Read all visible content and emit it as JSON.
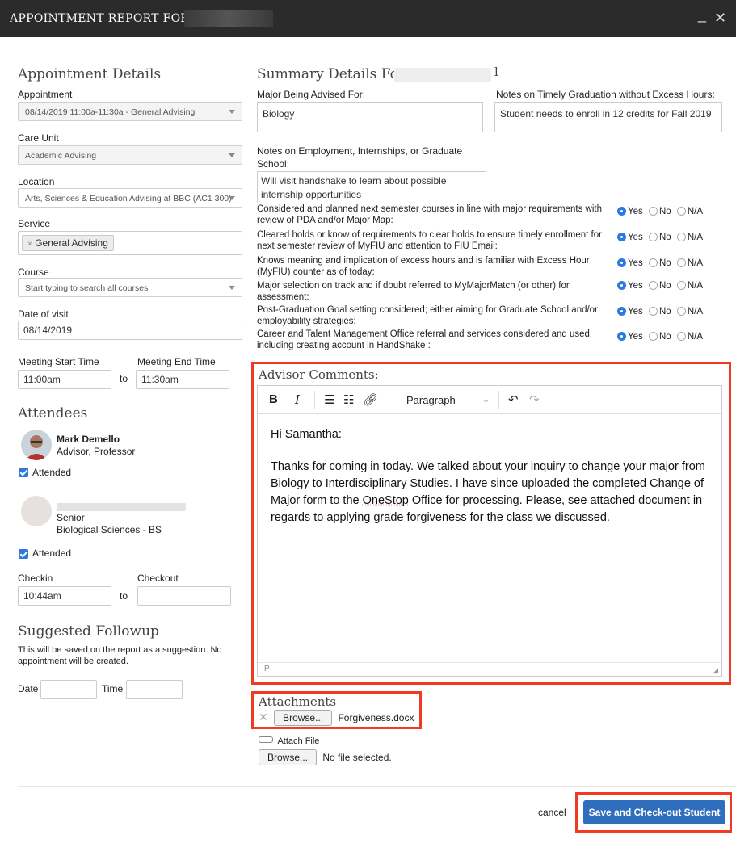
{
  "window": {
    "title": "APPOINTMENT REPORT FOR S",
    "minimize": "_",
    "close": "✕"
  },
  "left": {
    "section_title": "Appointment Details",
    "appointment": {
      "label": "Appointment",
      "value": "08/14/2019 11:00a-11:30a - General Advising"
    },
    "care_unit": {
      "label": "Care Unit",
      "value": "Academic Advising"
    },
    "location": {
      "label": "Location",
      "value": "Arts, Sciences & Education Advising at BBC (AC1 300)"
    },
    "service": {
      "label": "Service",
      "tag": "General Advising",
      "tag_x": "×"
    },
    "course": {
      "label": "Course",
      "placeholder": "Start typing to search all courses"
    },
    "date_of_visit": {
      "label": "Date of visit",
      "value": "08/14/2019"
    },
    "meeting": {
      "start_label": "Meeting Start Time",
      "end_label": "Meeting End Time",
      "start": "11:00am",
      "end": "11:30am",
      "to": "to"
    },
    "attendees": {
      "title": "Attendees",
      "advisor_name": "Mark Demello",
      "advisor_role": "Advisor, Professor",
      "attended1": "Attended",
      "student_level": "Senior",
      "student_program": "Biological Sciences - BS",
      "attended2": "Attended"
    },
    "checkin": {
      "label": "Checkin",
      "value": "10:44am",
      "checkout_label": "Checkout",
      "to": "to"
    },
    "followup": {
      "title": "Suggested Followup",
      "note": "This will be saved on the report as a suggestion. No appointment will be created.",
      "date_label": "Date",
      "time_label": "Time"
    }
  },
  "right": {
    "summary_title": "Summary Details For",
    "summary_suffix": "l",
    "major_label": "Major Being Advised For:",
    "major_value": "Biology",
    "timely_label": "Notes on Timely Graduation without Excess Hours:",
    "timely_value": "Student needs to enroll in 12 credits for Fall 2019",
    "employment_label": "Notes on Employment, Internships, or Graduate School:",
    "employment_value": "Will visit handshake to learn about possible internship opportunities",
    "radio_labels": {
      "yes": "Yes",
      "no": "No",
      "na": "N/A"
    },
    "questions": [
      {
        "text": "Considered and planned next semester courses in line with major requirements with review of PDA and/or Major Map:"
      },
      {
        "text": "Cleared holds or know of requirements to clear holds to ensure timely enrollment for next semester review of MyFIU and attention to FIU Email:"
      },
      {
        "text": "Knows meaning and implication of excess hours and is familiar with Excess Hour (MyFIU) counter as of today:"
      },
      {
        "text": "Major selection on track and if doubt referred to MyMajorMatch (or other) for assessment:"
      },
      {
        "text": "Post-Graduation Goal setting considered; either aiming for Graduate School and/or employability strategies:"
      },
      {
        "text": "Career and Talent Management Office referral and services considered and used, including creating account in HandShake :"
      }
    ],
    "comments": {
      "title": "Advisor Comments:",
      "format": "Paragraph",
      "greeting": "Hi Samantha:",
      "body_1": "Thanks for coming in today. We talked about your inquiry to change your major from Biology to Interdisciplinary Studies. I have since uploaded the completed Change of Major form to the ",
      "body_link": "OneStop",
      "body_2": " Office for processing. Please, see attached document in regards to applying grade forgiveness for the class we discussed.",
      "status": "P"
    },
    "attachments": {
      "title": "Attachments",
      "browse": "Browse...",
      "file": "Forgiveness.docx",
      "attach_label": "Attach File",
      "browse2": "Browse...",
      "no_file": "No file selected."
    }
  },
  "footer": {
    "cancel": "cancel",
    "save": "Save and Check-out Student"
  },
  "colors": {
    "accent": "#2f6dbd",
    "highlight": "#ef3b24",
    "titlebar": "#2b2b2b"
  }
}
